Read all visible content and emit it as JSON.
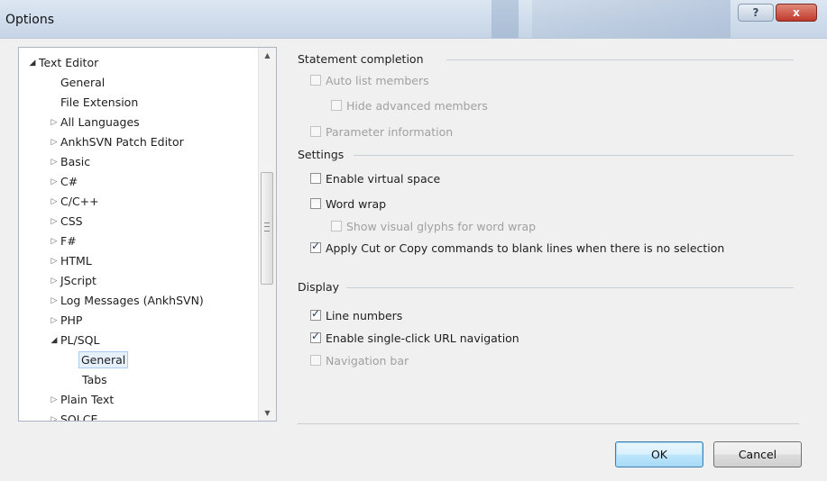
{
  "window": {
    "title": "Options"
  },
  "tree": {
    "items": [
      {
        "label": "Text Editor",
        "level": 0,
        "expander": "open"
      },
      {
        "label": "General",
        "level": 1,
        "expander": "none"
      },
      {
        "label": "File Extension",
        "level": 1,
        "expander": "none"
      },
      {
        "label": "All Languages",
        "level": 1,
        "expander": "closed"
      },
      {
        "label": "AnkhSVN Patch Editor",
        "level": 1,
        "expander": "closed"
      },
      {
        "label": "Basic",
        "level": 1,
        "expander": "closed"
      },
      {
        "label": "C#",
        "level": 1,
        "expander": "closed"
      },
      {
        "label": "C/C++",
        "level": 1,
        "expander": "closed"
      },
      {
        "label": "CSS",
        "level": 1,
        "expander": "closed"
      },
      {
        "label": "F#",
        "level": 1,
        "expander": "closed"
      },
      {
        "label": "HTML",
        "level": 1,
        "expander": "closed"
      },
      {
        "label": "JScript",
        "level": 1,
        "expander": "closed"
      },
      {
        "label": "Log Messages (AnkhSVN)",
        "level": 1,
        "expander": "closed"
      },
      {
        "label": "PHP",
        "level": 1,
        "expander": "closed"
      },
      {
        "label": "PL/SQL",
        "level": 1,
        "expander": "open"
      },
      {
        "label": "General",
        "level": 2,
        "expander": "none",
        "selected": true
      },
      {
        "label": "Tabs",
        "level": 2,
        "expander": "none"
      },
      {
        "label": "Plain Text",
        "level": 1,
        "expander": "closed"
      },
      {
        "label": "SOLCE",
        "level": 1,
        "expander": "closed"
      }
    ]
  },
  "groups": {
    "statement_completion": {
      "header": "Statement completion",
      "auto_list_members": {
        "label": "Auto list members",
        "checked": false,
        "enabled": false
      },
      "hide_advanced_members": {
        "label": "Hide advanced members",
        "checked": false,
        "enabled": false
      },
      "parameter_information": {
        "label": "Parameter information",
        "checked": false,
        "enabled": false
      }
    },
    "settings": {
      "header": "Settings",
      "enable_virtual_space": {
        "label": "Enable virtual space",
        "checked": false,
        "enabled": true
      },
      "word_wrap": {
        "label": "Word wrap",
        "checked": false,
        "enabled": true
      },
      "show_visual_glyphs": {
        "label": "Show visual glyphs for word wrap",
        "checked": false,
        "enabled": false
      },
      "apply_cut_copy": {
        "label": "Apply Cut or Copy commands to blank lines when there is no selection",
        "checked": true,
        "enabled": true
      }
    },
    "display": {
      "header": "Display",
      "line_numbers": {
        "label": "Line numbers",
        "checked": true,
        "enabled": true
      },
      "single_click_url": {
        "label": "Enable single-click URL navigation",
        "checked": true,
        "enabled": true
      },
      "navigation_bar": {
        "label": "Navigation bar",
        "checked": false,
        "enabled": false
      }
    }
  },
  "buttons": {
    "ok": "OK",
    "cancel": "Cancel"
  },
  "title_buttons": {
    "help": "?",
    "close": "x"
  }
}
